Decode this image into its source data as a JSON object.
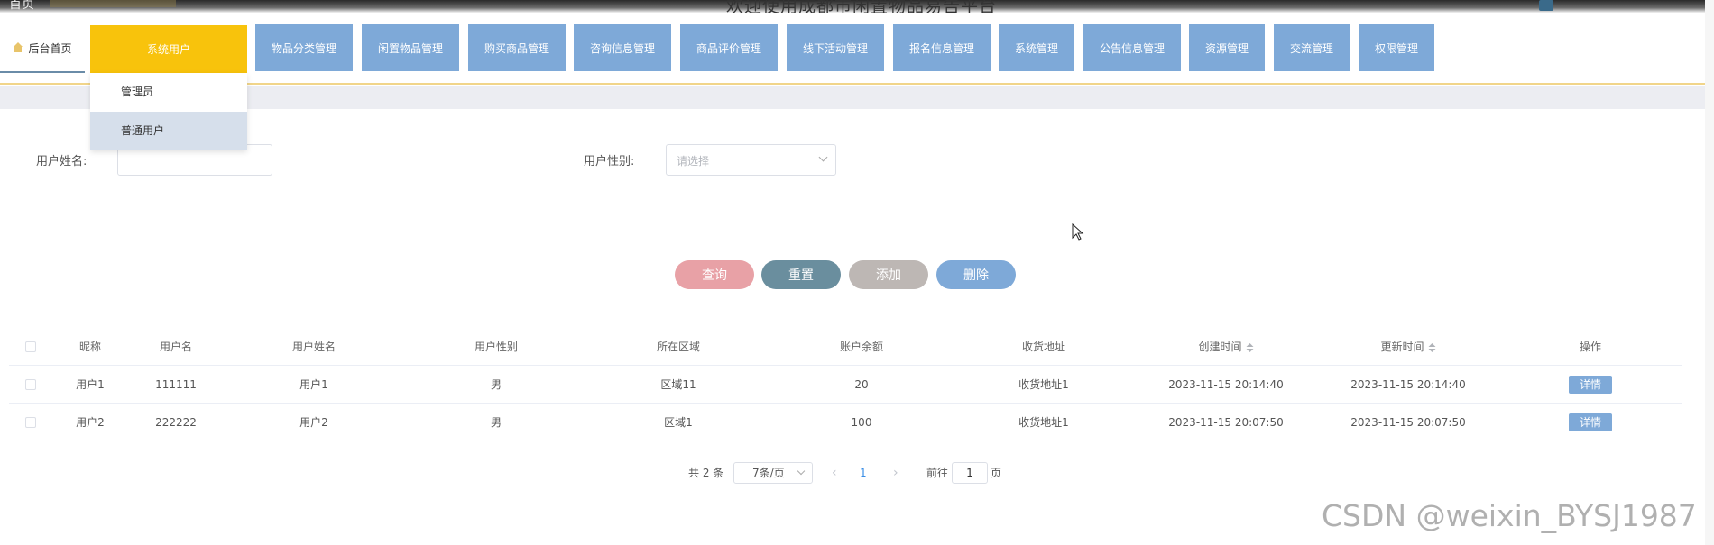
{
  "header": {
    "home_link": "首页",
    "site_title": "欢迎使用成都市闲置物品易告平台"
  },
  "nav": {
    "home_tab": "后台首页",
    "items": [
      {
        "label": "系统用户",
        "active": true
      },
      {
        "label": "物品分类管理"
      },
      {
        "label": "闲置物品管理"
      },
      {
        "label": "购买商品管理"
      },
      {
        "label": "咨询信息管理"
      },
      {
        "label": "商品评价管理"
      },
      {
        "label": "线下活动管理"
      },
      {
        "label": "报名信息管理"
      },
      {
        "label": "系统管理"
      },
      {
        "label": "公告信息管理"
      },
      {
        "label": "资源管理"
      },
      {
        "label": "交流管理"
      },
      {
        "label": "权限管理"
      }
    ],
    "dropdown": [
      "管理员",
      "普通用户"
    ],
    "dropdown_selected": "普通用户"
  },
  "search": {
    "name_label": "用户姓名:",
    "name_value": "",
    "gender_label": "用户性别:",
    "gender_placeholder": "请选择"
  },
  "actions": {
    "query": "查询",
    "reset": "重置",
    "add": "添加",
    "delete": "删除"
  },
  "table": {
    "columns": [
      "昵称",
      "用户名",
      "用户姓名",
      "用户性别",
      "所在区域",
      "账户余额",
      "收货地址",
      "创建时间",
      "更新时间",
      "操作"
    ],
    "rows": [
      {
        "nickname": "用户1",
        "username": "111111",
        "real_name": "用户1",
        "gender": "男",
        "region": "区域11",
        "balance": "20",
        "address": "收货地址1",
        "created": "2023-11-15 20:14:40",
        "updated": "2023-11-15 20:14:40",
        "action": "详情"
      },
      {
        "nickname": "用户2",
        "username": "222222",
        "real_name": "用户2",
        "gender": "男",
        "region": "区域1",
        "balance": "100",
        "address": "收货地址1",
        "created": "2023-11-15 20:07:50",
        "updated": "2023-11-15 20:07:50",
        "action": "详情"
      }
    ]
  },
  "pagination": {
    "total": "共 2 条",
    "page_size": "7条/页",
    "current_page": "1",
    "goto_label": "前往",
    "goto_value": "1",
    "page_suffix": "页"
  },
  "watermark": "CSDN @weixin_BYSJ1987",
  "colors": {
    "nav_button": "#7ea9d8",
    "nav_active": "#f8c30c",
    "query_button": "#e8a1a6",
    "reset_button": "#6a8e9e",
    "add_button": "#bdb7b4",
    "delete_button": "#7ea9d8"
  }
}
